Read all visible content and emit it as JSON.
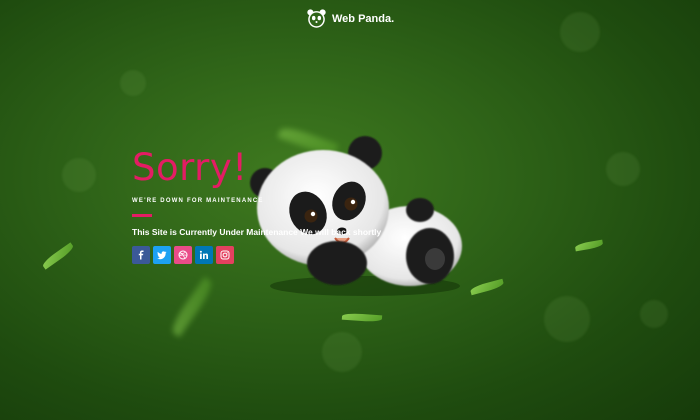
{
  "brand": {
    "name": "Web Panda."
  },
  "main": {
    "headline": "Sorry!",
    "subheadline": "WE'RE DOWN FOR MAINTENANCE",
    "description": "This Site is Currently Under Maintenance We will back shortly"
  },
  "socials": [
    {
      "icon": "facebook-icon",
      "label": "f",
      "color": "#3b5998"
    },
    {
      "icon": "twitter-icon",
      "label": "t",
      "color": "#1da1f2"
    },
    {
      "icon": "dribbble-icon",
      "label": "d",
      "color": "#ea4c89"
    },
    {
      "icon": "linkedin-icon",
      "label": "in",
      "color": "#0077b5"
    },
    {
      "icon": "instagram-icon",
      "label": "ig",
      "color": "#e4405f"
    }
  ],
  "colors": {
    "accent": "#e41c64",
    "background": "#2f6418"
  }
}
